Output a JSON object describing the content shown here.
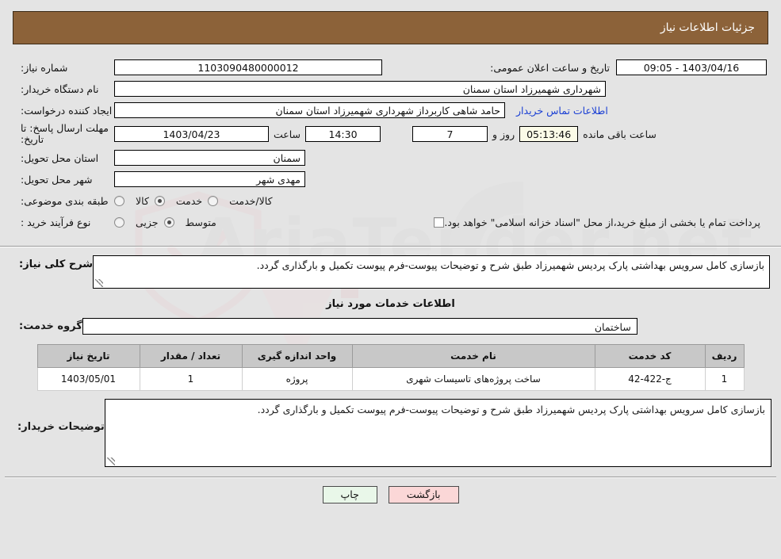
{
  "header": {
    "title": "جزئیات اطلاعات نیاز"
  },
  "info": {
    "need_number_label": "شماره نیاز:",
    "need_number_value": "1103090480000012",
    "announce_label": "تاریخ و ساعت اعلان عمومی:",
    "announce_value": "1403/04/16 - 09:05",
    "buyer_org_label": "نام دستگاه خریدار:",
    "buyer_org_value": "شهرداری شهمیرزاد استان سمنان",
    "creator_label": "ایجاد کننده درخواست:",
    "creator_value": "حامد شاهی کاربرداز شهرداری شهمیرزاد استان سمنان",
    "contact_link": "اطلاعات تماس خریدار",
    "deadline_label": "مهلت ارسال پاسخ: تا تاریخ:",
    "deadline_date": "1403/04/23",
    "hour_label": "ساعت",
    "hour_value": "14:30",
    "days_value": "7",
    "days_label": "روز و",
    "countdown_value": "05:13:46",
    "countdown_label": "ساعت باقی مانده",
    "province_label": "استان محل تحویل:",
    "province_value": "سمنان",
    "city_label": "شهر محل تحویل:",
    "city_value": "مهدی شهر",
    "category_label": "طبقه بندی موضوعی:",
    "category_options": [
      {
        "label": "کالا",
        "selected": false
      },
      {
        "label": "خدمت",
        "selected": true
      },
      {
        "label": "کالا/خدمت",
        "selected": false
      }
    ],
    "process_label": "نوع فرآیند خرید :",
    "process_options": [
      {
        "label": "جزیی",
        "selected": false
      },
      {
        "label": "متوسط",
        "selected": true
      }
    ],
    "treasury_checkbox_text": "پرداخت تمام یا بخشی از مبلغ خرید،از محل \"اسناد خزانه اسلامی\" خواهد بود.",
    "treasury_checked": false
  },
  "description": {
    "label": "شرح کلی نیاز:",
    "text": "بازسازی کامل سرویس بهداشتی پارک پردیس شهمیرزاد طبق شرح و توضیحات پیوست-فرم پیوست تکمیل و بارگذاری گردد."
  },
  "services": {
    "section_title": "اطلاعات خدمات مورد نیاز",
    "group_label": "گروه خدمت:",
    "group_value": "ساختمان",
    "columns": [
      "ردیف",
      "کد خدمت",
      "نام خدمت",
      "واحد اندازه گیری",
      "تعداد / مقدار",
      "تاریخ نیاز"
    ],
    "rows": [
      {
        "radif": "1",
        "code": "ج-422-42",
        "name": "ساخت پروژه‌های تاسیسات شهری",
        "unit": "پروژه",
        "quantity": "1",
        "date": "1403/05/01"
      }
    ]
  },
  "notes": {
    "label": "توضیحات خریدار:",
    "text": "بازسازی کامل سرویس بهداشتی پارک پردیس شهمیرزاد طبق شرح و توضیحات پیوست-فرم پیوست تکمیل و بارگذاری گردد."
  },
  "footer": {
    "print_label": "چاپ",
    "back_label": "بازگشت"
  },
  "watermark": {
    "text": "AriaTender.net"
  },
  "colors": {
    "header_bg": "#8c6239",
    "link": "#1a3fd4",
    "print_btn": "#e9f7e9",
    "back_btn": "#fbd7d7",
    "table_header": "#c8c8c8",
    "countdown_bg": "#fbfbe8"
  }
}
